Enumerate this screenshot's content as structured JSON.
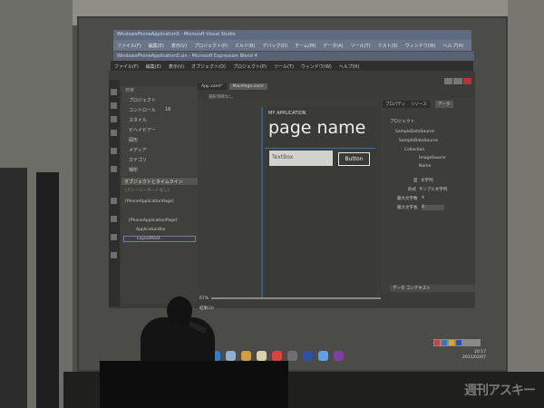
{
  "vs_window": {
    "title": "WindowsPhoneApplication5 - Microsoft Visual Studio",
    "menu": [
      "ファイル(F)",
      "編集(E)",
      "表示(V)",
      "プロジェクト(P)",
      "ビルド(B)",
      "デバッグ(D)",
      "チーム(M)",
      "データ(A)",
      "ツール(T)",
      "テスト(S)",
      "ウィンドウ(W)",
      "ヘルプ(H)"
    ]
  },
  "blend_window": {
    "title": "WindowsPhoneApplication5.sln - Microsoft Expression Blend 4",
    "menu": [
      "ファイル(F)",
      "編集(E)",
      "表示(V)",
      "オブジェクト(O)",
      "プロジェクト(P)",
      "ツール(T)",
      "ウィンドウ(W)",
      "ヘルプ(H)"
    ]
  },
  "assets": {
    "search_placeholder": "検索",
    "items": [
      "プロジェクト",
      "コントロール",
      "スタイル",
      "ビヘイビアー",
      "図形",
      "メディア",
      "カテゴリ",
      "場所"
    ],
    "counts": [
      "4",
      "16",
      "",
      "6",
      "2",
      "2",
      "",
      ""
    ]
  },
  "objects_panel": {
    "title": "オブジェクトとタイムライン",
    "storyboard": "(ストーリーボードなし)",
    "items": [
      "[PhoneApplicationPage]",
      "[PhoneApplicationPage]",
      "ApplicationBar",
      "LayoutRoot"
    ]
  },
  "document_tabs": [
    {
      "label": "App.xaml*",
      "active": false
    },
    {
      "label": "MainPage.xaml",
      "active": true
    }
  ],
  "artboard_label": "選択項目なし",
  "phone": {
    "app_title": "MY APPLICATION",
    "page_title": "page name",
    "textbox_text": "TextBox",
    "button_label": "Button"
  },
  "zoom_level": "67%",
  "results_label": "結果(U)",
  "properties_panel": {
    "tabs": [
      "プロパティ",
      "リソース",
      "データ"
    ],
    "items": [
      "プロジェクト",
      "SampleDataSource",
      "SampleDataSource",
      "Collection",
      "ImageSource",
      "Name"
    ],
    "type_label": "型",
    "type_value": "文字列",
    "format_label": "形式",
    "format_value": "サンプル文字列",
    "max_words_label": "最大文字数",
    "max_words_value": "4",
    "max_length_label": "最大文字長",
    "max_length_value": "8",
    "data_context": "データ コンテキスト"
  },
  "clock": {
    "time": "20:17",
    "date": "2011/02/07"
  },
  "taskbar_colors": [
    "#2a7fd4",
    "#8fb0d0",
    "#d0a040",
    "#d9d1a8",
    "#e04040",
    "#707070",
    "#3050a0",
    "#60a0e0",
    "#8040a0"
  ],
  "watermark": "週刊アスキー"
}
